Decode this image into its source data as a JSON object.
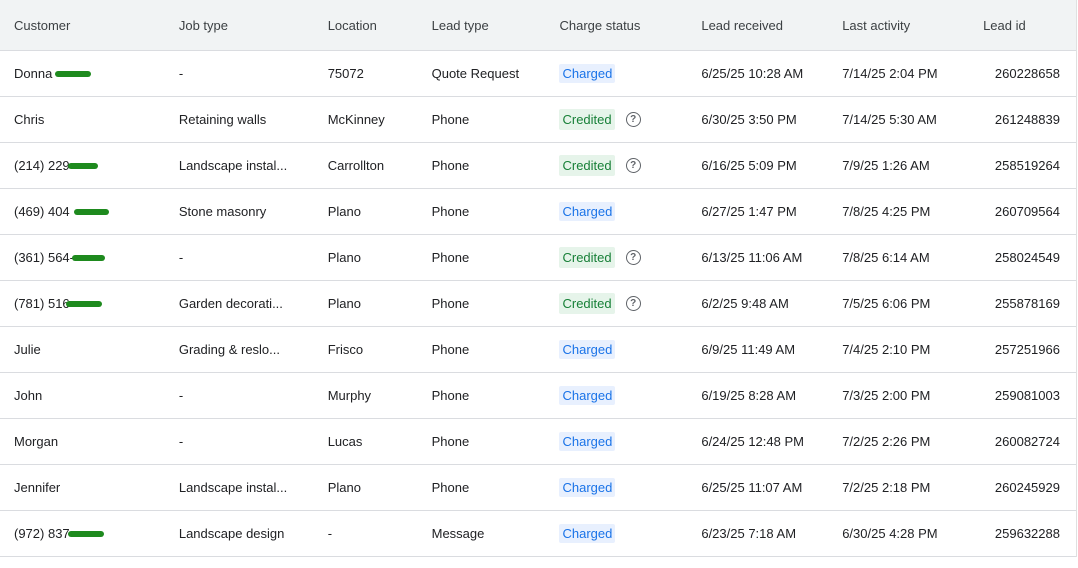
{
  "columns": {
    "customer": "Customer",
    "job_type": "Job type",
    "location": "Location",
    "lead_type": "Lead type",
    "charge_status": "Charge status",
    "lead_received": "Lead received",
    "last_activity": "Last activity",
    "lead_id": "Lead id"
  },
  "colors": {
    "charged_bg": "#e8f0fe",
    "charged_text": "#1a73e8",
    "credited_bg": "#e6f4ea",
    "credited_text": "#188038",
    "redaction": "#1e8a1e"
  },
  "rows": [
    {
      "customer": "Donna",
      "job_type": "-",
      "location": "75072",
      "lead_type": "Quote Request",
      "status": "Charged",
      "received": "6/25/25 10:28 AM",
      "activity": "7/14/25 2:04 PM",
      "lead_id": "260228658"
    },
    {
      "customer": "Chris",
      "job_type": "Retaining walls",
      "location": "McKinney",
      "lead_type": "Phone",
      "status": "Credited",
      "received": "6/30/25 3:50 PM",
      "activity": "7/14/25 5:30 AM",
      "lead_id": "261248839"
    },
    {
      "customer": "(214) 229",
      "job_type": "Landscape instal...",
      "location": "Carrollton",
      "lead_type": "Phone",
      "status": "Credited",
      "received": "6/16/25 5:09 PM",
      "activity": "7/9/25 1:26 AM",
      "lead_id": "258519264"
    },
    {
      "customer": "(469) 404",
      "job_type": "Stone masonry",
      "location": "Plano",
      "lead_type": "Phone",
      "status": "Charged",
      "received": "6/27/25 1:47 PM",
      "activity": "7/8/25 4:25 PM",
      "lead_id": "260709564"
    },
    {
      "customer": "(361) 564-",
      "job_type": "-",
      "location": "Plano",
      "lead_type": "Phone",
      "status": "Credited",
      "received": "6/13/25 11:06 AM",
      "activity": "7/8/25 6:14 AM",
      "lead_id": "258024549"
    },
    {
      "customer": "(781) 516",
      "job_type": "Garden decorati...",
      "location": "Plano",
      "lead_type": "Phone",
      "status": "Credited",
      "received": "6/2/25 9:48 AM",
      "activity": "7/5/25 6:06 PM",
      "lead_id": "255878169"
    },
    {
      "customer": "Julie",
      "job_type": "Grading & reslo...",
      "location": "Frisco",
      "lead_type": "Phone",
      "status": "Charged",
      "received": "6/9/25 11:49 AM",
      "activity": "7/4/25 2:10 PM",
      "lead_id": "257251966"
    },
    {
      "customer": "John",
      "job_type": "-",
      "location": "Murphy",
      "lead_type": "Phone",
      "status": "Charged",
      "received": "6/19/25 8:28 AM",
      "activity": "7/3/25 2:00 PM",
      "lead_id": "259081003"
    },
    {
      "customer": "Morgan",
      "job_type": "-",
      "location": "Lucas",
      "lead_type": "Phone",
      "status": "Charged",
      "received": "6/24/25 12:48 PM",
      "activity": "7/2/25 2:26 PM",
      "lead_id": "260082724"
    },
    {
      "customer": "Jennifer",
      "job_type": "Landscape instal...",
      "location": "Plano",
      "lead_type": "Phone",
      "status": "Charged",
      "received": "6/25/25 11:07 AM",
      "activity": "7/2/25 2:18 PM",
      "lead_id": "260245929"
    },
    {
      "customer": "(972) 837",
      "job_type": "Landscape design",
      "location": "-",
      "lead_type": "Message",
      "status": "Charged",
      "received": "6/23/25 7:18 AM",
      "activity": "6/30/25 4:28 PM",
      "lead_id": "259632288"
    }
  ],
  "help_glyph": "?"
}
